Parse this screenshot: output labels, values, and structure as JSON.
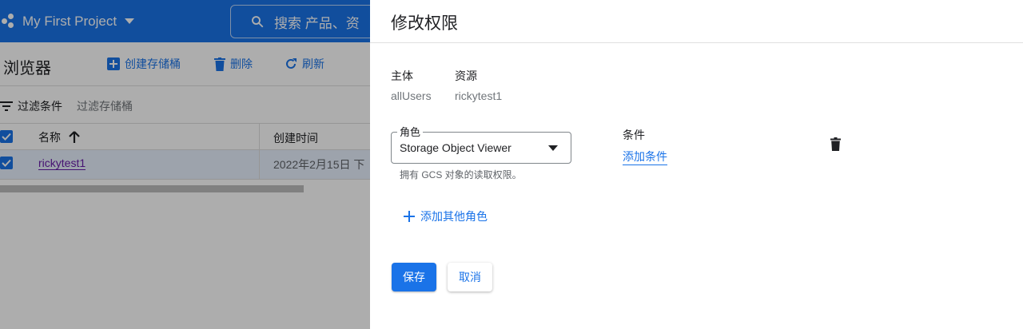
{
  "app": {
    "project_name": "My First Project",
    "search_placeholder": "搜索 产品、资"
  },
  "toolbar": {
    "title": "浏览器",
    "create_bucket": "创建存储桶",
    "delete": "删除",
    "refresh": "刷新"
  },
  "filter": {
    "label": "过滤条件",
    "placeholder": "过滤存储桶"
  },
  "table": {
    "columns": [
      "名称",
      "创建时间"
    ],
    "rows": [
      {
        "name": "rickytest1",
        "created": "2022年2月15日 下"
      }
    ]
  },
  "panel": {
    "title": "修改权限",
    "principal_label": "主体",
    "principal_value": "allUsers",
    "resource_label": "资源",
    "resource_value": "rickytest1",
    "role_label": "角色",
    "role_value": "Storage Object Viewer",
    "role_help": "拥有 GCS 对象的读取权限。",
    "condition_label": "条件",
    "add_condition": "添加条件",
    "add_role": "添加其他角色",
    "save": "保存",
    "cancel": "取消"
  },
  "colors": {
    "brand": "#1a73e8",
    "overlay": "rgba(0,0,0,0.32)"
  }
}
